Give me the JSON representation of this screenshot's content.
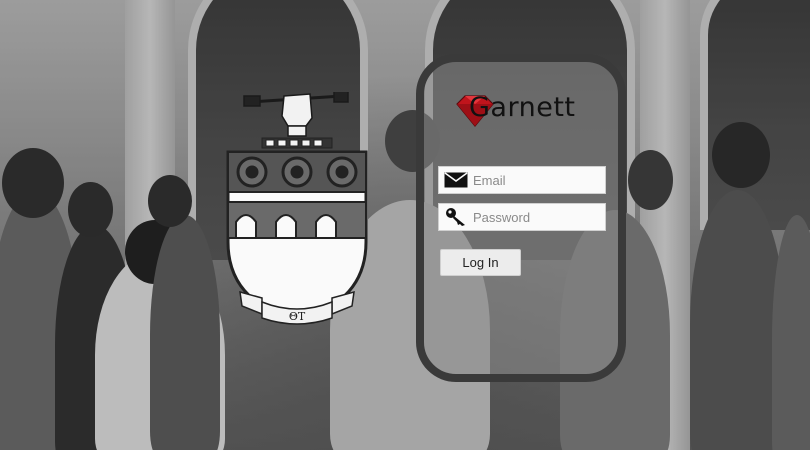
{
  "brand": {
    "name": "Garnett",
    "gem_color": "#c0141c"
  },
  "crest": {
    "motto": "ΘΤ"
  },
  "login": {
    "email_placeholder": "Email",
    "password_placeholder": "Password",
    "submit_label": "Log In"
  },
  "icons": {
    "email": "envelope-icon",
    "password": "key-icon"
  }
}
